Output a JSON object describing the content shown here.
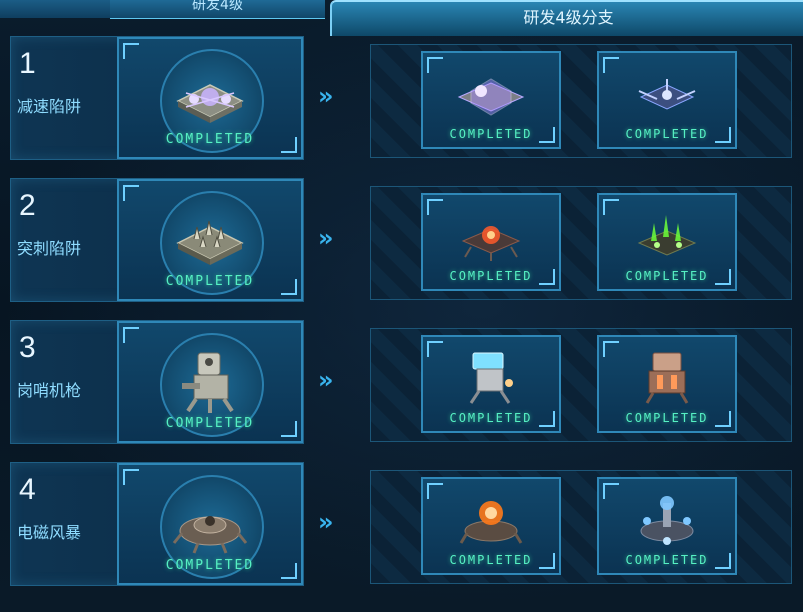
{
  "header": {
    "left_tab": "",
    "mid_tab": "研发4级",
    "right_tab": "研发4级分支"
  },
  "rows": [
    {
      "number": "1",
      "name": "减速陷阱",
      "main": {
        "status": "COMPLETED",
        "icon": "slow-trap-icon"
      },
      "branches": [
        {
          "status": "COMPLETED",
          "icon": "hex-shield-trap-icon",
          "glow": "#b58cff"
        },
        {
          "status": "COMPLETED",
          "icon": "drone-trap-icon",
          "glow": "#8aa6ff"
        }
      ]
    },
    {
      "number": "2",
      "name": "突刺陷阱",
      "main": {
        "status": "COMPLETED",
        "icon": "spike-trap-icon"
      },
      "branches": [
        {
          "status": "COMPLETED",
          "icon": "fire-spike-trap-icon",
          "glow": "#ff5a2a"
        },
        {
          "status": "COMPLETED",
          "icon": "toxic-spike-trap-icon",
          "glow": "#6cff3a"
        }
      ]
    },
    {
      "number": "3",
      "name": "岗哨机枪",
      "main": {
        "status": "COMPLETED",
        "icon": "sentry-gun-icon"
      },
      "branches": [
        {
          "status": "COMPLETED",
          "icon": "ice-sentry-icon",
          "glow": "#7fe0ff"
        },
        {
          "status": "COMPLETED",
          "icon": "heavy-sentry-icon",
          "glow": "#ff9a5a"
        }
      ]
    },
    {
      "number": "4",
      "name": "电磁风暴",
      "main": {
        "status": "COMPLETED",
        "icon": "emp-storm-icon"
      },
      "branches": [
        {
          "status": "COMPLETED",
          "icon": "fire-emp-icon",
          "glow": "#ff7a1a"
        },
        {
          "status": "COMPLETED",
          "icon": "tesla-emp-icon",
          "glow": "#7fc8ff"
        }
      ]
    }
  ],
  "colors": {
    "completed": "#56f0c3",
    "accent": "#39b4ee",
    "panel": "#0e3553"
  }
}
